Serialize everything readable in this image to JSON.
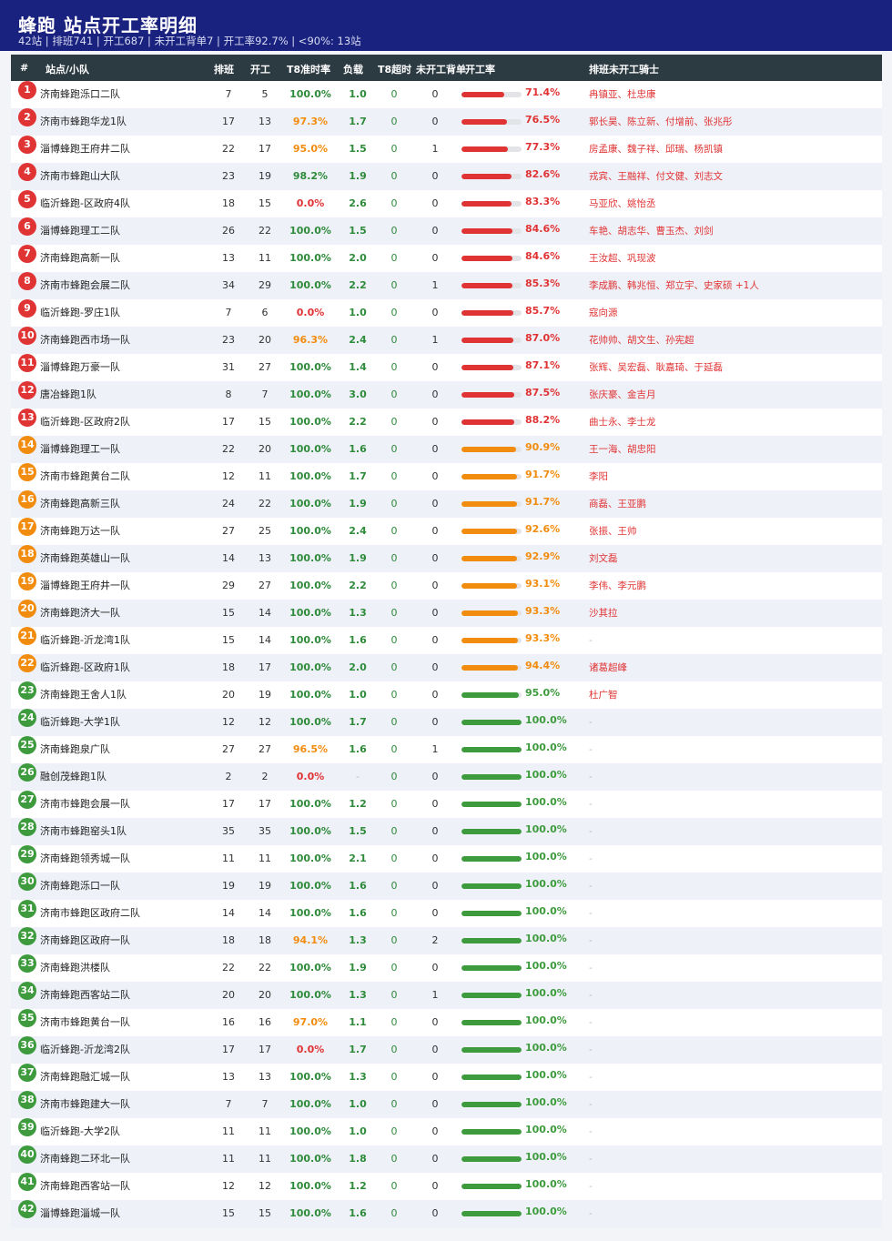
{
  "header": {
    "title": "蜂跑 站点开工率明细",
    "subtitle": "42站 | 排班741 | 开工687 | 未开工背单7 | 开工率92.7% | <90%: 13站"
  },
  "columns": {
    "rank": "#",
    "station": "站点/小队",
    "scheduled": "排班",
    "started": "开工",
    "t8_rate": "T8准时率",
    "load": "负载",
    "t8_timeout": "T8超时",
    "not_started_backlog": "未开工背单",
    "start_rate": "开工率",
    "riders": "排班未开工骑士"
  },
  "colors": {
    "header_bg": "#1a2280",
    "table_head_bg": "#2c3a42",
    "red": "#e03434",
    "orange": "#f28c0e",
    "green": "#3d9b3d"
  },
  "rows": [
    {
      "rank": "1",
      "name": "济南蜂跑泺口二队",
      "scheduled": "7",
      "started": "5",
      "t8": "100.0%",
      "load": "1.0",
      "timeout": "0",
      "backlog": "0",
      "rate": "71.4%",
      "rate_value": 71.4,
      "riders": "冉镇亚、杜忠康"
    },
    {
      "rank": "2",
      "name": "济南市蜂跑华龙1队",
      "scheduled": "17",
      "started": "13",
      "t8": "97.3%",
      "load": "1.7",
      "timeout": "0",
      "backlog": "0",
      "rate": "76.5%",
      "rate_value": 76.5,
      "riders": "郭长昊、陈立新、付增前、张兆彤"
    },
    {
      "rank": "3",
      "name": "淄博蜂跑王府井二队",
      "scheduled": "22",
      "started": "17",
      "t8": "95.0%",
      "load": "1.5",
      "timeout": "0",
      "backlog": "1",
      "rate": "77.3%",
      "rate_value": 77.3,
      "riders": "房孟康、魏子祥、邱瑞、杨凯镇"
    },
    {
      "rank": "4",
      "name": "济南市蜂跑山大队",
      "scheduled": "23",
      "started": "19",
      "t8": "98.2%",
      "load": "1.9",
      "timeout": "0",
      "backlog": "0",
      "rate": "82.6%",
      "rate_value": 82.6,
      "riders": "戎宾、王融祥、付文健、刘志文"
    },
    {
      "rank": "5",
      "name": "临沂蜂跑-区政府4队",
      "scheduled": "18",
      "started": "15",
      "t8": "0.0%",
      "load": "2.6",
      "timeout": "0",
      "backlog": "0",
      "rate": "83.3%",
      "rate_value": 83.3,
      "riders": "马亚欣、姚怡丞"
    },
    {
      "rank": "6",
      "name": "淄博蜂跑理工二队",
      "scheduled": "26",
      "started": "22",
      "t8": "100.0%",
      "load": "1.5",
      "timeout": "0",
      "backlog": "0",
      "rate": "84.6%",
      "rate_value": 84.6,
      "riders": "车艳、胡志华、曹玉杰、刘剑"
    },
    {
      "rank": "7",
      "name": "济南蜂跑高新一队",
      "scheduled": "13",
      "started": "11",
      "t8": "100.0%",
      "load": "2.0",
      "timeout": "0",
      "backlog": "0",
      "rate": "84.6%",
      "rate_value": 84.6,
      "riders": "王汝超、巩现波"
    },
    {
      "rank": "8",
      "name": "济南市蜂跑会展二队",
      "scheduled": "34",
      "started": "29",
      "t8": "100.0%",
      "load": "2.2",
      "timeout": "0",
      "backlog": "1",
      "rate": "85.3%",
      "rate_value": 85.3,
      "riders": "李成鹏、韩兆恒、郑立宇、史家硕 +1人"
    },
    {
      "rank": "9",
      "name": "临沂蜂跑-罗庄1队",
      "scheduled": "7",
      "started": "6",
      "t8": "0.0%",
      "load": "1.0",
      "timeout": "0",
      "backlog": "0",
      "rate": "85.7%",
      "rate_value": 85.7,
      "riders": "寇向源"
    },
    {
      "rank": "10",
      "name": "济南蜂跑西市场一队",
      "scheduled": "23",
      "started": "20",
      "t8": "96.3%",
      "load": "2.4",
      "timeout": "0",
      "backlog": "1",
      "rate": "87.0%",
      "rate_value": 87.0,
      "riders": "花帅帅、胡文生、孙宪超"
    },
    {
      "rank": "11",
      "name": "淄博蜂跑万豪一队",
      "scheduled": "31",
      "started": "27",
      "t8": "100.0%",
      "load": "1.4",
      "timeout": "0",
      "backlog": "0",
      "rate": "87.1%",
      "rate_value": 87.1,
      "riders": "张辉、吴宏磊、耿嘉琦、于延磊"
    },
    {
      "rank": "12",
      "name": "唐冶蜂跑1队",
      "scheduled": "8",
      "started": "7",
      "t8": "100.0%",
      "load": "3.0",
      "timeout": "0",
      "backlog": "0",
      "rate": "87.5%",
      "rate_value": 87.5,
      "riders": "张庆豪、金吉月"
    },
    {
      "rank": "13",
      "name": "临沂蜂跑-区政府2队",
      "scheduled": "17",
      "started": "15",
      "t8": "100.0%",
      "load": "2.2",
      "timeout": "0",
      "backlog": "0",
      "rate": "88.2%",
      "rate_value": 88.2,
      "riders": "曲士永、李士龙"
    },
    {
      "rank": "14",
      "name": "淄博蜂跑理工一队",
      "scheduled": "22",
      "started": "20",
      "t8": "100.0%",
      "load": "1.6",
      "timeout": "0",
      "backlog": "0",
      "rate": "90.9%",
      "rate_value": 90.9,
      "riders": "王一海、胡忠阳"
    },
    {
      "rank": "15",
      "name": "济南市蜂跑黄台二队",
      "scheduled": "12",
      "started": "11",
      "t8": "100.0%",
      "load": "1.7",
      "timeout": "0",
      "backlog": "0",
      "rate": "91.7%",
      "rate_value": 91.7,
      "riders": "李阳"
    },
    {
      "rank": "16",
      "name": "济南蜂跑高新三队",
      "scheduled": "24",
      "started": "22",
      "t8": "100.0%",
      "load": "1.9",
      "timeout": "0",
      "backlog": "0",
      "rate": "91.7%",
      "rate_value": 91.7,
      "riders": "商磊、王亚鹏"
    },
    {
      "rank": "17",
      "name": "济南蜂跑万达一队",
      "scheduled": "27",
      "started": "25",
      "t8": "100.0%",
      "load": "2.4",
      "timeout": "0",
      "backlog": "0",
      "rate": "92.6%",
      "rate_value": 92.6,
      "riders": "张振、王帅"
    },
    {
      "rank": "18",
      "name": "济南蜂跑英雄山一队",
      "scheduled": "14",
      "started": "13",
      "t8": "100.0%",
      "load": "1.9",
      "timeout": "0",
      "backlog": "0",
      "rate": "92.9%",
      "rate_value": 92.9,
      "riders": "刘文磊"
    },
    {
      "rank": "19",
      "name": "淄博蜂跑王府井一队",
      "scheduled": "29",
      "started": "27",
      "t8": "100.0%",
      "load": "2.2",
      "timeout": "0",
      "backlog": "0",
      "rate": "93.1%",
      "rate_value": 93.1,
      "riders": "李伟、李元鹏"
    },
    {
      "rank": "20",
      "name": "济南蜂跑济大一队",
      "scheduled": "15",
      "started": "14",
      "t8": "100.0%",
      "load": "1.3",
      "timeout": "0",
      "backlog": "0",
      "rate": "93.3%",
      "rate_value": 93.3,
      "riders": "沙其拉"
    },
    {
      "rank": "21",
      "name": "临沂蜂跑-沂龙湾1队",
      "scheduled": "15",
      "started": "14",
      "t8": "100.0%",
      "load": "1.6",
      "timeout": "0",
      "backlog": "0",
      "rate": "93.3%",
      "rate_value": 93.3,
      "riders": "-"
    },
    {
      "rank": "22",
      "name": "临沂蜂跑-区政府1队",
      "scheduled": "18",
      "started": "17",
      "t8": "100.0%",
      "load": "2.0",
      "timeout": "0",
      "backlog": "0",
      "rate": "94.4%",
      "rate_value": 94.4,
      "riders": "诸葛超峰"
    },
    {
      "rank": "23",
      "name": "济南蜂跑王舍人1队",
      "scheduled": "20",
      "started": "19",
      "t8": "100.0%",
      "load": "1.0",
      "timeout": "0",
      "backlog": "0",
      "rate": "95.0%",
      "rate_value": 95.0,
      "riders": "杜广智"
    },
    {
      "rank": "24",
      "name": "临沂蜂跑-大学1队",
      "scheduled": "12",
      "started": "12",
      "t8": "100.0%",
      "load": "1.7",
      "timeout": "0",
      "backlog": "0",
      "rate": "100.0%",
      "rate_value": 100,
      "riders": "-"
    },
    {
      "rank": "25",
      "name": "济南蜂跑泉广队",
      "scheduled": "27",
      "started": "27",
      "t8": "96.5%",
      "load": "1.6",
      "timeout": "0",
      "backlog": "1",
      "rate": "100.0%",
      "rate_value": 100,
      "riders": "-"
    },
    {
      "rank": "26",
      "name": "融创茂蜂跑1队",
      "scheduled": "2",
      "started": "2",
      "t8": "0.0%",
      "load": "-",
      "timeout": "0",
      "backlog": "0",
      "rate": "100.0%",
      "rate_value": 100,
      "riders": "-"
    },
    {
      "rank": "27",
      "name": "济南市蜂跑会展一队",
      "scheduled": "17",
      "started": "17",
      "t8": "100.0%",
      "load": "1.2",
      "timeout": "0",
      "backlog": "0",
      "rate": "100.0%",
      "rate_value": 100,
      "riders": "-"
    },
    {
      "rank": "28",
      "name": "济南市蜂跑窑头1队",
      "scheduled": "35",
      "started": "35",
      "t8": "100.0%",
      "load": "1.5",
      "timeout": "0",
      "backlog": "0",
      "rate": "100.0%",
      "rate_value": 100,
      "riders": "-"
    },
    {
      "rank": "29",
      "name": "济南蜂跑领秀城一队",
      "scheduled": "11",
      "started": "11",
      "t8": "100.0%",
      "load": "2.1",
      "timeout": "0",
      "backlog": "0",
      "rate": "100.0%",
      "rate_value": 100,
      "riders": "-"
    },
    {
      "rank": "30",
      "name": "济南蜂跑泺口一队",
      "scheduled": "19",
      "started": "19",
      "t8": "100.0%",
      "load": "1.6",
      "timeout": "0",
      "backlog": "0",
      "rate": "100.0%",
      "rate_value": 100,
      "riders": "-"
    },
    {
      "rank": "31",
      "name": "济南市蜂跑区政府二队",
      "scheduled": "14",
      "started": "14",
      "t8": "100.0%",
      "load": "1.6",
      "timeout": "0",
      "backlog": "0",
      "rate": "100.0%",
      "rate_value": 100,
      "riders": "-"
    },
    {
      "rank": "32",
      "name": "济南蜂跑区政府一队",
      "scheduled": "18",
      "started": "18",
      "t8": "94.1%",
      "load": "1.3",
      "timeout": "0",
      "backlog": "2",
      "rate": "100.0%",
      "rate_value": 100,
      "riders": "-"
    },
    {
      "rank": "33",
      "name": "济南蜂跑洪楼队",
      "scheduled": "22",
      "started": "22",
      "t8": "100.0%",
      "load": "1.9",
      "timeout": "0",
      "backlog": "0",
      "rate": "100.0%",
      "rate_value": 100,
      "riders": "-"
    },
    {
      "rank": "34",
      "name": "济南蜂跑西客站二队",
      "scheduled": "20",
      "started": "20",
      "t8": "100.0%",
      "load": "1.3",
      "timeout": "0",
      "backlog": "1",
      "rate": "100.0%",
      "rate_value": 100,
      "riders": "-"
    },
    {
      "rank": "35",
      "name": "济南市蜂跑黄台一队",
      "scheduled": "16",
      "started": "16",
      "t8": "97.0%",
      "load": "1.1",
      "timeout": "0",
      "backlog": "0",
      "rate": "100.0%",
      "rate_value": 100,
      "riders": "-"
    },
    {
      "rank": "36",
      "name": "临沂蜂跑-沂龙湾2队",
      "scheduled": "17",
      "started": "17",
      "t8": "0.0%",
      "load": "1.7",
      "timeout": "0",
      "backlog": "0",
      "rate": "100.0%",
      "rate_value": 100,
      "riders": "-"
    },
    {
      "rank": "37",
      "name": "济南蜂跑融汇城一队",
      "scheduled": "13",
      "started": "13",
      "t8": "100.0%",
      "load": "1.3",
      "timeout": "0",
      "backlog": "0",
      "rate": "100.0%",
      "rate_value": 100,
      "riders": "-"
    },
    {
      "rank": "38",
      "name": "济南市蜂跑建大一队",
      "scheduled": "7",
      "started": "7",
      "t8": "100.0%",
      "load": "1.0",
      "timeout": "0",
      "backlog": "0",
      "rate": "100.0%",
      "rate_value": 100,
      "riders": "-"
    },
    {
      "rank": "39",
      "name": "临沂蜂跑-大学2队",
      "scheduled": "11",
      "started": "11",
      "t8": "100.0%",
      "load": "1.0",
      "timeout": "0",
      "backlog": "0",
      "rate": "100.0%",
      "rate_value": 100,
      "riders": "-"
    },
    {
      "rank": "40",
      "name": "济南蜂跑二环北一队",
      "scheduled": "11",
      "started": "11",
      "t8": "100.0%",
      "load": "1.8",
      "timeout": "0",
      "backlog": "0",
      "rate": "100.0%",
      "rate_value": 100,
      "riders": "-"
    },
    {
      "rank": "41",
      "name": "济南蜂跑西客站一队",
      "scheduled": "12",
      "started": "12",
      "t8": "100.0%",
      "load": "1.2",
      "timeout": "0",
      "backlog": "0",
      "rate": "100.0%",
      "rate_value": 100,
      "riders": "-"
    },
    {
      "rank": "42",
      "name": "淄博蜂跑淄城一队",
      "scheduled": "15",
      "started": "15",
      "t8": "100.0%",
      "load": "1.6",
      "timeout": "0",
      "backlog": "0",
      "rate": "100.0%",
      "rate_value": 100,
      "riders": "-"
    }
  ]
}
